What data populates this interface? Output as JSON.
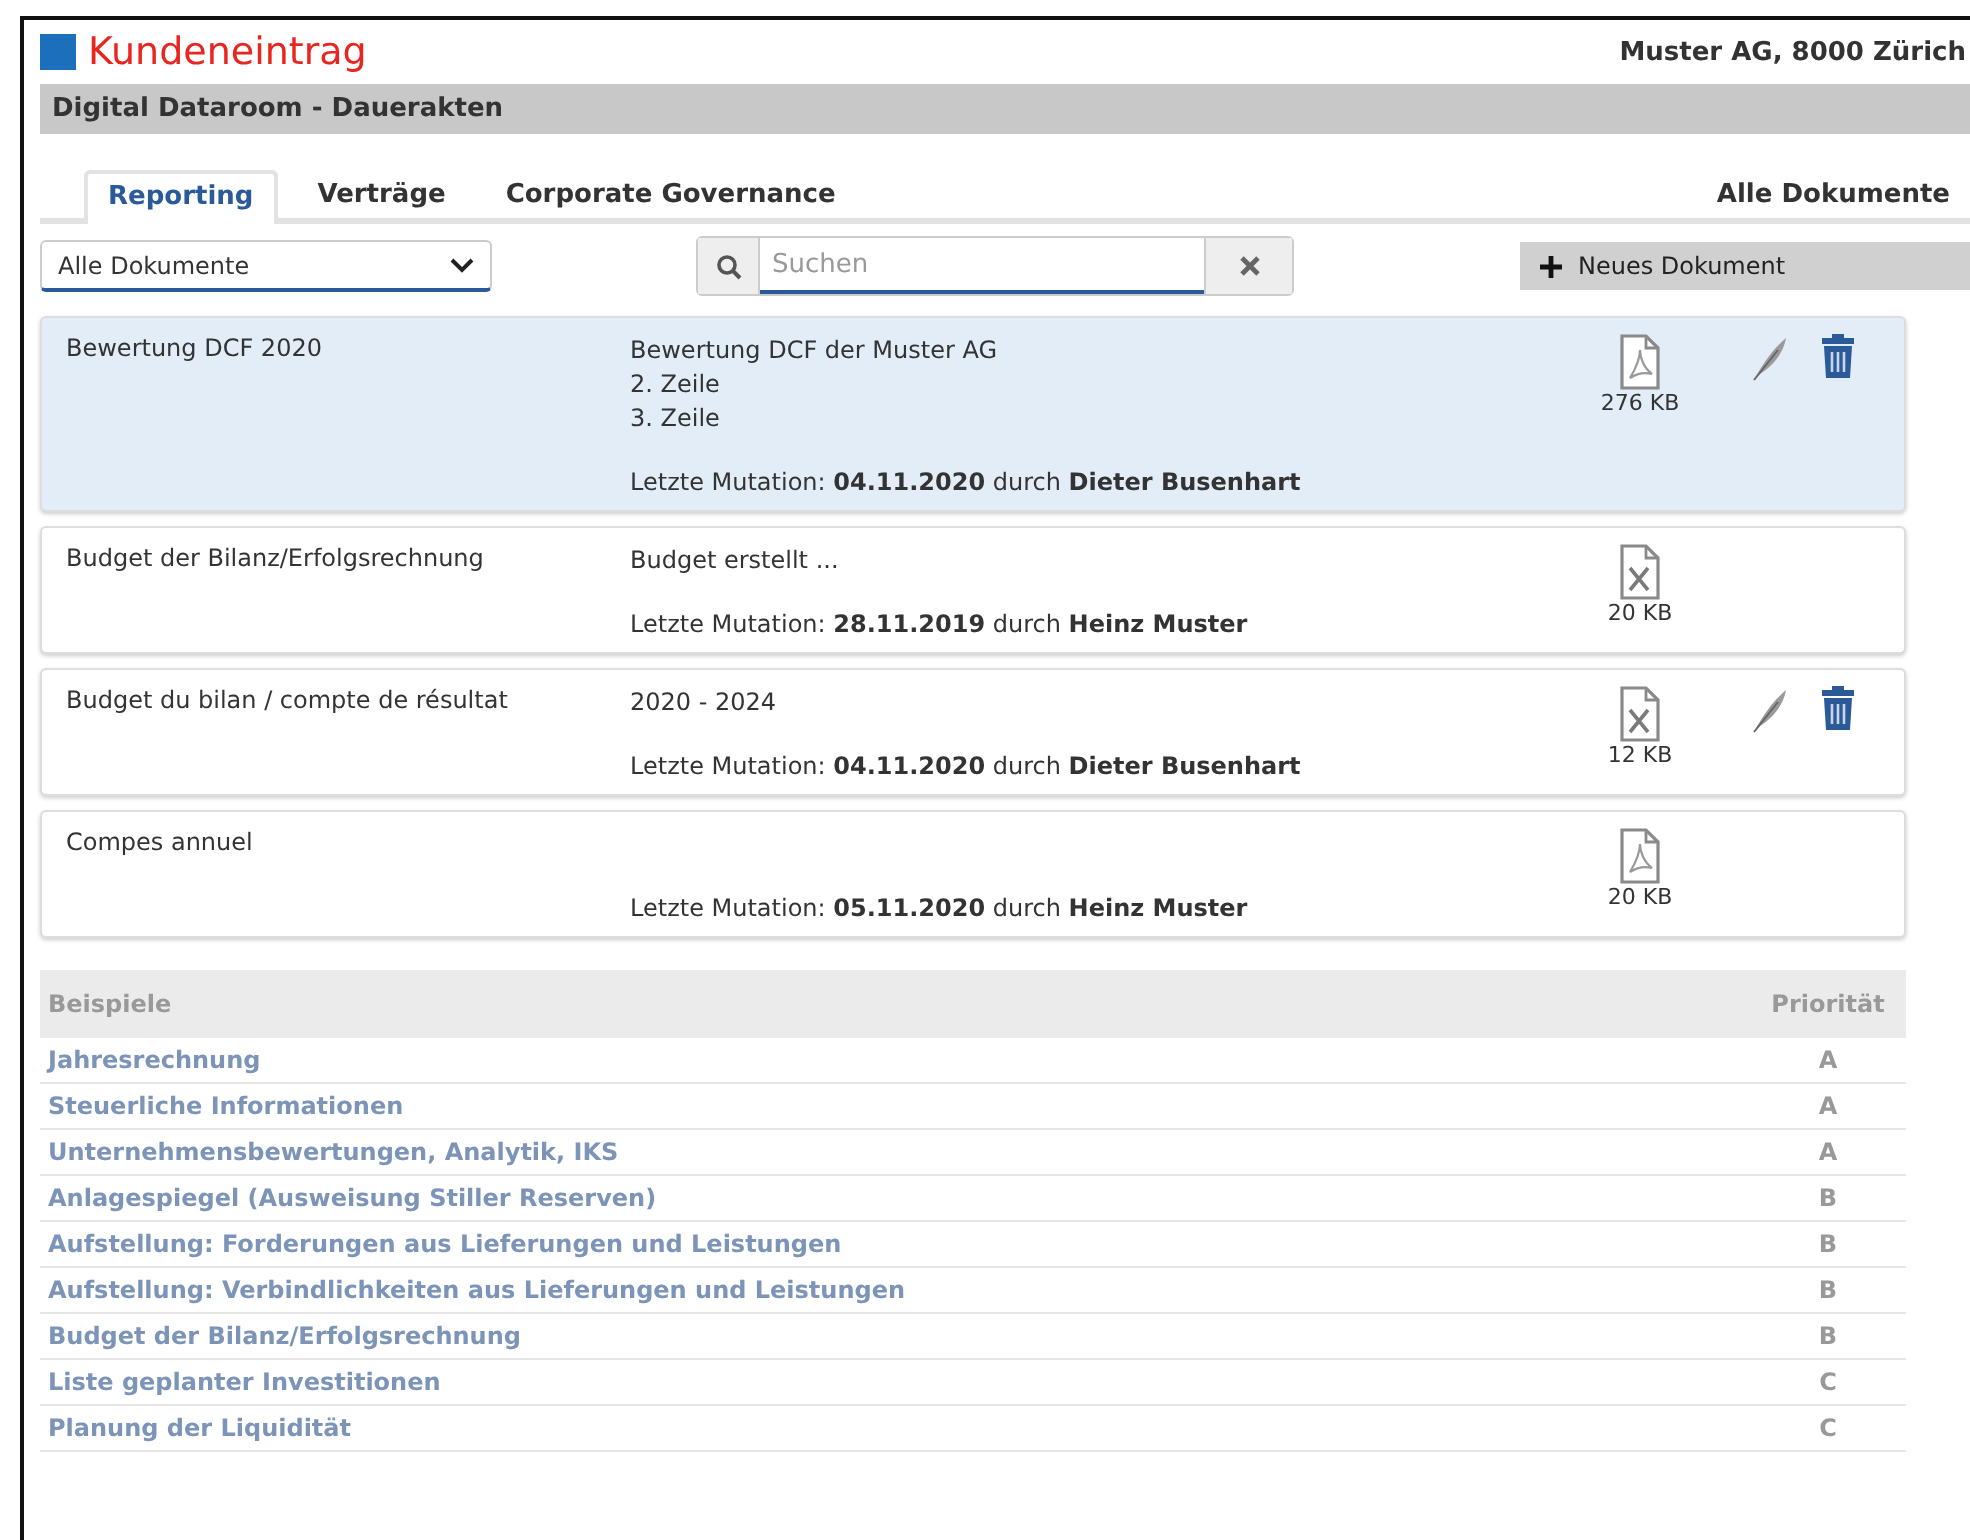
{
  "header": {
    "title": "Kundeneintrag",
    "client": "Muster AG, 8000 Zürich"
  },
  "section_title": "Digital Dataroom - Dauerakten",
  "tabs": [
    {
      "label": "Reporting",
      "selected": true
    },
    {
      "label": "Verträge",
      "selected": false
    },
    {
      "label": "Corporate Governance",
      "selected": false
    }
  ],
  "all_documents_link": "Alle Dokumente",
  "filter": {
    "value": "Alle Dokumente"
  },
  "search": {
    "placeholder": "Suchen"
  },
  "new_button": "Neues Dokument",
  "documents": [
    {
      "title": "Bewertung DCF 2020",
      "lines": [
        "Bewertung DCF der Muster AG",
        "2. Zeile",
        "3. Zeile"
      ],
      "mutation": "Letzte Mutation: **04.11.2020** durch **Dieter Busenhart**",
      "kind": "pdf",
      "size": "276 KB",
      "editable": true,
      "selected": true
    },
    {
      "title": "Budget der Bilanz/Erfolgsrechnung",
      "lines": [
        "Budget erstellt ..."
      ],
      "mutation": "Letzte Mutation: **28.11.2019** durch **Heinz Muster**",
      "kind": "xls",
      "size": "20 KB",
      "editable": false,
      "selected": false
    },
    {
      "title": "Budget du bilan / compte de résultat",
      "lines": [
        "2020 - 2024"
      ],
      "mutation": "Letzte Mutation: **04.11.2020** durch **Dieter Busenhart**",
      "kind": "xls",
      "size": "12 KB",
      "editable": true,
      "selected": false
    },
    {
      "title": "Compes annuel",
      "mutation": "Letzte Mutation: **05.11.2020** durch **Heinz Muster**",
      "kind": "pdf",
      "size": "20 KB",
      "editable": false,
      "selected": false
    }
  ],
  "examples": {
    "columns": [
      "Beispiele",
      "Priorität"
    ],
    "rows": [
      {
        "name": "Jahresrechnung",
        "priority": "A"
      },
      {
        "name": "Steuerliche Informationen",
        "priority": "A"
      },
      {
        "name": "Unternehmensbewertungen, Analytik, IKS",
        "priority": "A"
      },
      {
        "name": "Anlagespiegel (Ausweisung Stiller Reserven)",
        "priority": "B"
      },
      {
        "name": "Aufstellung: Forderungen aus Lieferungen und Leistungen",
        "priority": "B"
      },
      {
        "name": "Aufstellung: Verbindlichkeiten aus Lieferungen und Leistungen",
        "priority": "B"
      },
      {
        "name": "Budget der Bilanz/Erfolgsrechnung",
        "priority": "B"
      },
      {
        "name": "Liste geplanter Investitionen",
        "priority": "C"
      },
      {
        "name": "Planung der Liquidität",
        "priority": "C"
      }
    ]
  }
}
